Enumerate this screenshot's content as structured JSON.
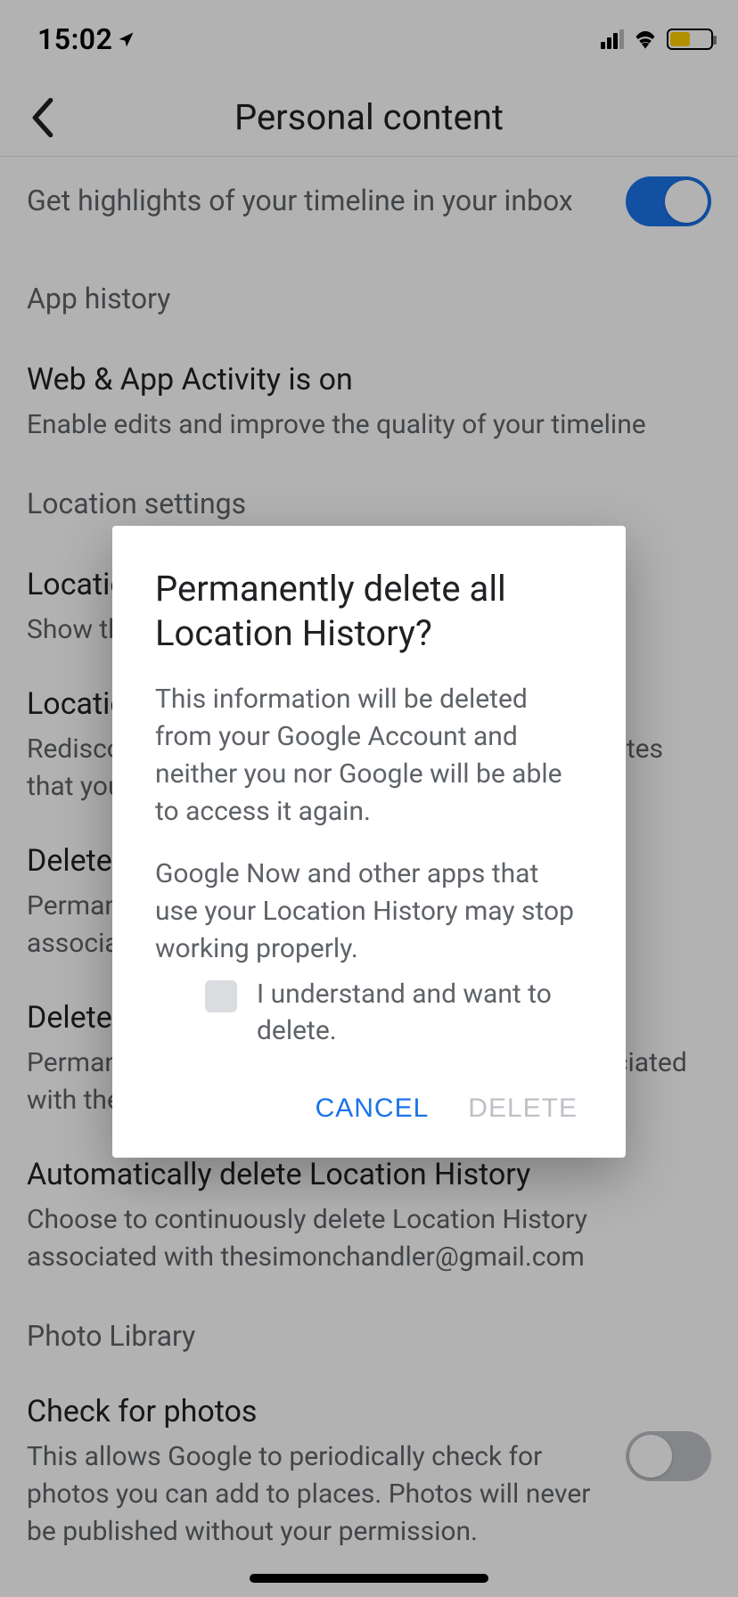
{
  "statusbar": {
    "time": "15:02"
  },
  "nav": {
    "title": "Personal content"
  },
  "rows": {
    "highlights_label": "Get highlights of your timeline in your inbox"
  },
  "sections": {
    "app_history": "App history",
    "location_settings": "Location settings",
    "photo_library": "Photo Library"
  },
  "items": {
    "web_activity": {
      "title": "Web & App Activity is on",
      "sub": "Enable edits and improve the quality of your timeline"
    },
    "loc_services": {
      "title": "Location Services is on",
      "sub": "Show the blue dot on the map"
    },
    "loc_history": {
      "title": "Location History is on",
      "sub": "Rediscover the places that you've been and the routes that you've travelled in your timeline"
    },
    "delete_range": {
      "title": "Delete Location History range",
      "sub": "Permanently delete part of your Location History associated with thesimonchandler@gmail.com"
    },
    "delete_all": {
      "title": "Delete all Location History",
      "sub": "Permanently delete all your Location History associated with thesimonchandler@gmail.com"
    },
    "auto_delete": {
      "title": "Automatically delete Location History",
      "sub": "Choose to continuously delete Location History associated with thesimonchandler@gmail.com"
    },
    "check_photos": {
      "title": "Check for photos",
      "sub": "This allows Google to periodically check for photos you can add to places. Photos will never be published without your permission."
    }
  },
  "modal": {
    "title": "Permanently delete all Location History?",
    "p1": "This information will be deleted from your Google Account and neither you nor Google will be able to access it again.",
    "p2": "Google Now and other apps that use your Location History may stop working properly.",
    "consent": "I understand and want to delete.",
    "cancel": "CANCEL",
    "delete": "DELETE"
  }
}
